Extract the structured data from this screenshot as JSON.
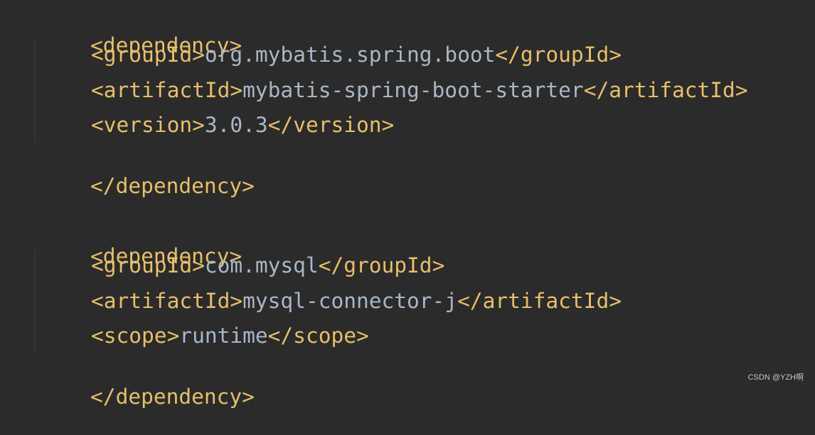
{
  "code": {
    "dep1": {
      "open": "<dependency>",
      "close": "</dependency>",
      "group_open": "<groupId>",
      "group_value": "org.mybatis.spring.boot",
      "group_close": "</groupId>",
      "artifact_open": "<artifactId>",
      "artifact_value": "mybatis-spring-boot-starter",
      "artifact_close": "</artifactId>",
      "version_open": "<version>",
      "version_value": "3.0.3",
      "version_close": "</version>"
    },
    "dep2": {
      "open": "<dependency>",
      "close": "</dependency>",
      "group_open": "<groupId>",
      "group_value": "com.mysql",
      "group_close": "</groupId>",
      "artifact_open": "<artifactId>",
      "artifact_value": "mysql-connector-j",
      "artifact_close": "</artifactId>",
      "scope_open": "<scope>",
      "scope_value": "runtime",
      "scope_close": "</scope>"
    }
  },
  "colors": {
    "background": "#2b2b2b",
    "tag": "#e8bf6a",
    "text": "#a9b7c6",
    "indent_guide": "#3d3d3d"
  },
  "watermark": "CSDN @YZH啊"
}
